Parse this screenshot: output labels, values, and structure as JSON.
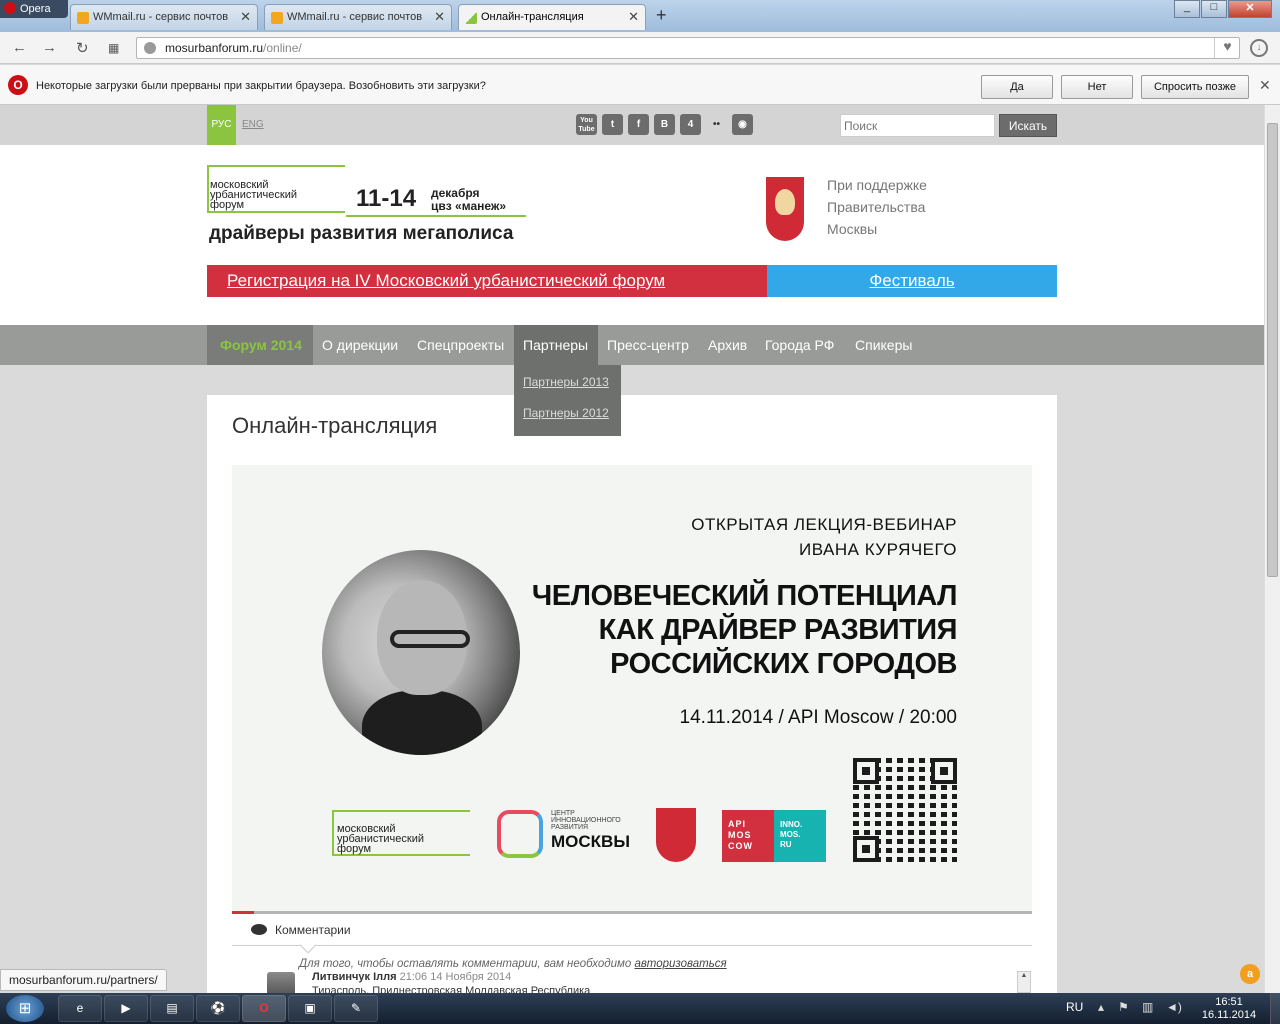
{
  "browser": {
    "menu_label": "Opera",
    "tabs": [
      {
        "title": "WMmail.ru - сервис почтов"
      },
      {
        "title": "WMmail.ru - сервис почтов"
      },
      {
        "title": "Онлайн-трансляция"
      }
    ],
    "new_tab_label": "+",
    "window_controls": {
      "minimize": "_",
      "maximize": "□",
      "close": "✕"
    },
    "url_host": "mosurbanforum.ru",
    "url_path": "/online/",
    "infobar": {
      "message": "Некоторые загрузки были прерваны при закрытии браузера. Возобновить эти загрузки?",
      "yes_label": "Да",
      "no_label": "Нет",
      "later_label": "Спросить позже"
    },
    "status_url": "mosurbanforum.ru/partners/"
  },
  "site": {
    "lang": {
      "rus": "РУС",
      "eng": "ENG"
    },
    "social": [
      {
        "icon": "youtube-icon",
        "glyph": "You Tube"
      },
      {
        "icon": "twitter-icon",
        "glyph": "t"
      },
      {
        "icon": "facebook-icon",
        "glyph": "f"
      },
      {
        "icon": "vkontakte-icon",
        "glyph": "B"
      },
      {
        "icon": "foursquare-icon",
        "glyph": "4"
      },
      {
        "icon": "flickr-icon",
        "glyph": "••"
      },
      {
        "icon": "instagram-icon",
        "glyph": "◉"
      }
    ],
    "search": {
      "placeholder": "Поиск",
      "button_label": "Искать"
    },
    "logo": {
      "line1": "московский",
      "line2": "урбанистический",
      "line3": "форум",
      "dates": "11-14",
      "venue1": "декабря",
      "venue2": "цвз «манеж»",
      "slogan": "драйверы развития мегаполиса"
    },
    "support": {
      "line1": "При поддержке",
      "line2": "Правительства",
      "line3": "Москвы"
    },
    "banners": {
      "registration": "Регистрация на IV Московский урбанистический форум",
      "festival": "Фестиваль"
    },
    "nav": [
      {
        "label": "Форум 2014"
      },
      {
        "label": "О дирекции"
      },
      {
        "label": "Спецпроекты"
      },
      {
        "label": "Партнеры"
      },
      {
        "label": "Пресс-центр"
      },
      {
        "label": "Архив"
      },
      {
        "label": "Города РФ"
      },
      {
        "label": "Спикеры"
      }
    ],
    "submenu": [
      {
        "label": "Партнеры 2013"
      },
      {
        "label": "Партнеры 2012"
      }
    ],
    "page_title": "Онлайн-трансляция",
    "webinar": {
      "line1": "ОТКРЫТАЯ ЛЕКЦИЯ-ВЕБИНАР",
      "line2": "ИВАНА КУРЯЧЕГО",
      "headline1": "ЧЕЛОВЕЧЕСКИЙ ПОТЕНЦИАЛ",
      "headline2": "КАК ДРАЙВЕР РАЗВИТИЯ",
      "headline3": "РОССИЙСКИХ ГОРОДОВ",
      "date": "14.11.2014 / API Moscow / 20:00",
      "forum_logo": {
        "line1": "московский",
        "line2": "урбанистический",
        "line3": "форум"
      },
      "center_logo": {
        "small1": "ЦЕНТР",
        "small2": "ИННОВАЦИОННОГО",
        "small3": "РАЗВИТИЯ",
        "big": "МОСКВЫ"
      },
      "api_logo": {
        "l1": "API",
        "l2": "MOS",
        "l3": "COW"
      },
      "inno_logo": {
        "l1": "INNO.",
        "l2": "MOS.",
        "l3": "RU"
      }
    },
    "comments": {
      "tab_label": "Комментарии",
      "login_hint": "Для того, чтобы оставлять комментарии, вам необходимо",
      "login_link": "авторизоваться",
      "first_comment": {
        "author": "Литвинчук Ілля",
        "time": "21:06 14 Ноября 2014",
        "text": "Тирасполь, Приднестровская Молдавская Республика"
      }
    }
  },
  "taskbar": {
    "start_label": "⊞",
    "apps": [
      {
        "icon": "internet-explorer-icon",
        "glyph": "e"
      },
      {
        "icon": "media-player-icon",
        "glyph": "▶"
      },
      {
        "icon": "explorer-folder-icon",
        "glyph": "▤"
      },
      {
        "icon": "soccer-app-icon",
        "glyph": "⚽"
      },
      {
        "icon": "opera-icon",
        "glyph": "O"
      },
      {
        "icon": "film-app-icon",
        "glyph": "▣"
      },
      {
        "icon": "paint-app-icon",
        "glyph": "✎"
      }
    ],
    "language": "RU",
    "time": "16:51",
    "date": "16.11.2014"
  },
  "colors": {
    "accent_green": "#8bc53f",
    "registration_red": "#d22f3f",
    "festival_blue": "#33a8e8",
    "nav_gray": "#999b98"
  }
}
